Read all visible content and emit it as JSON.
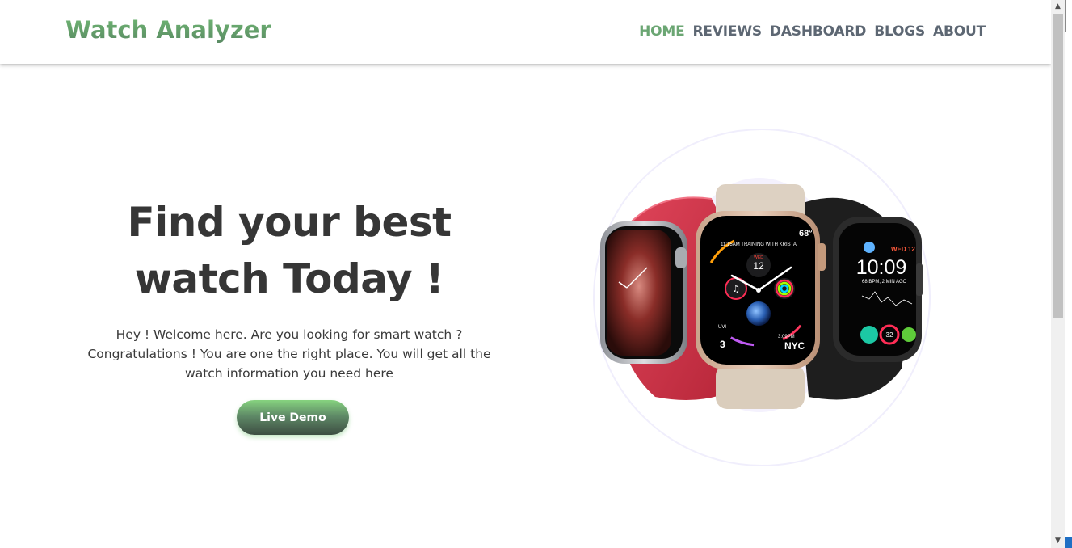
{
  "brand": {
    "name": "Watch Analyzer"
  },
  "nav": {
    "items": [
      {
        "label": "HOME",
        "active": true
      },
      {
        "label": "REVIEWS",
        "active": false
      },
      {
        "label": "DASHBOARD",
        "active": false
      },
      {
        "label": "BLOGS",
        "active": false
      },
      {
        "label": "ABOUT",
        "active": false
      }
    ]
  },
  "hero": {
    "title_line1": "Find your best",
    "title_line2": "watch Today !",
    "description": "Hey ! Welcome here. Are you looking for smart watch ? Congratulations ! You are one the right place. You will get all the watch information you need here",
    "cta_label": "Live Demo"
  },
  "watch_faces": {
    "center": {
      "day": "WED",
      "date": "12",
      "top_text": "11:15AM TRAINING WITH KRISTA",
      "temp": "68°",
      "uv": "UVI",
      "uv_value": "3",
      "time_bottom": "3:09PM",
      "city": "NYC"
    },
    "right": {
      "day": "WED 12",
      "time": "10:09",
      "bpm": "68 BPM, 2 MIN AGO",
      "ring_value": "32"
    }
  },
  "colors": {
    "accent": "#6ba673",
    "nav_text": "#5d6773",
    "heading": "#363636"
  }
}
